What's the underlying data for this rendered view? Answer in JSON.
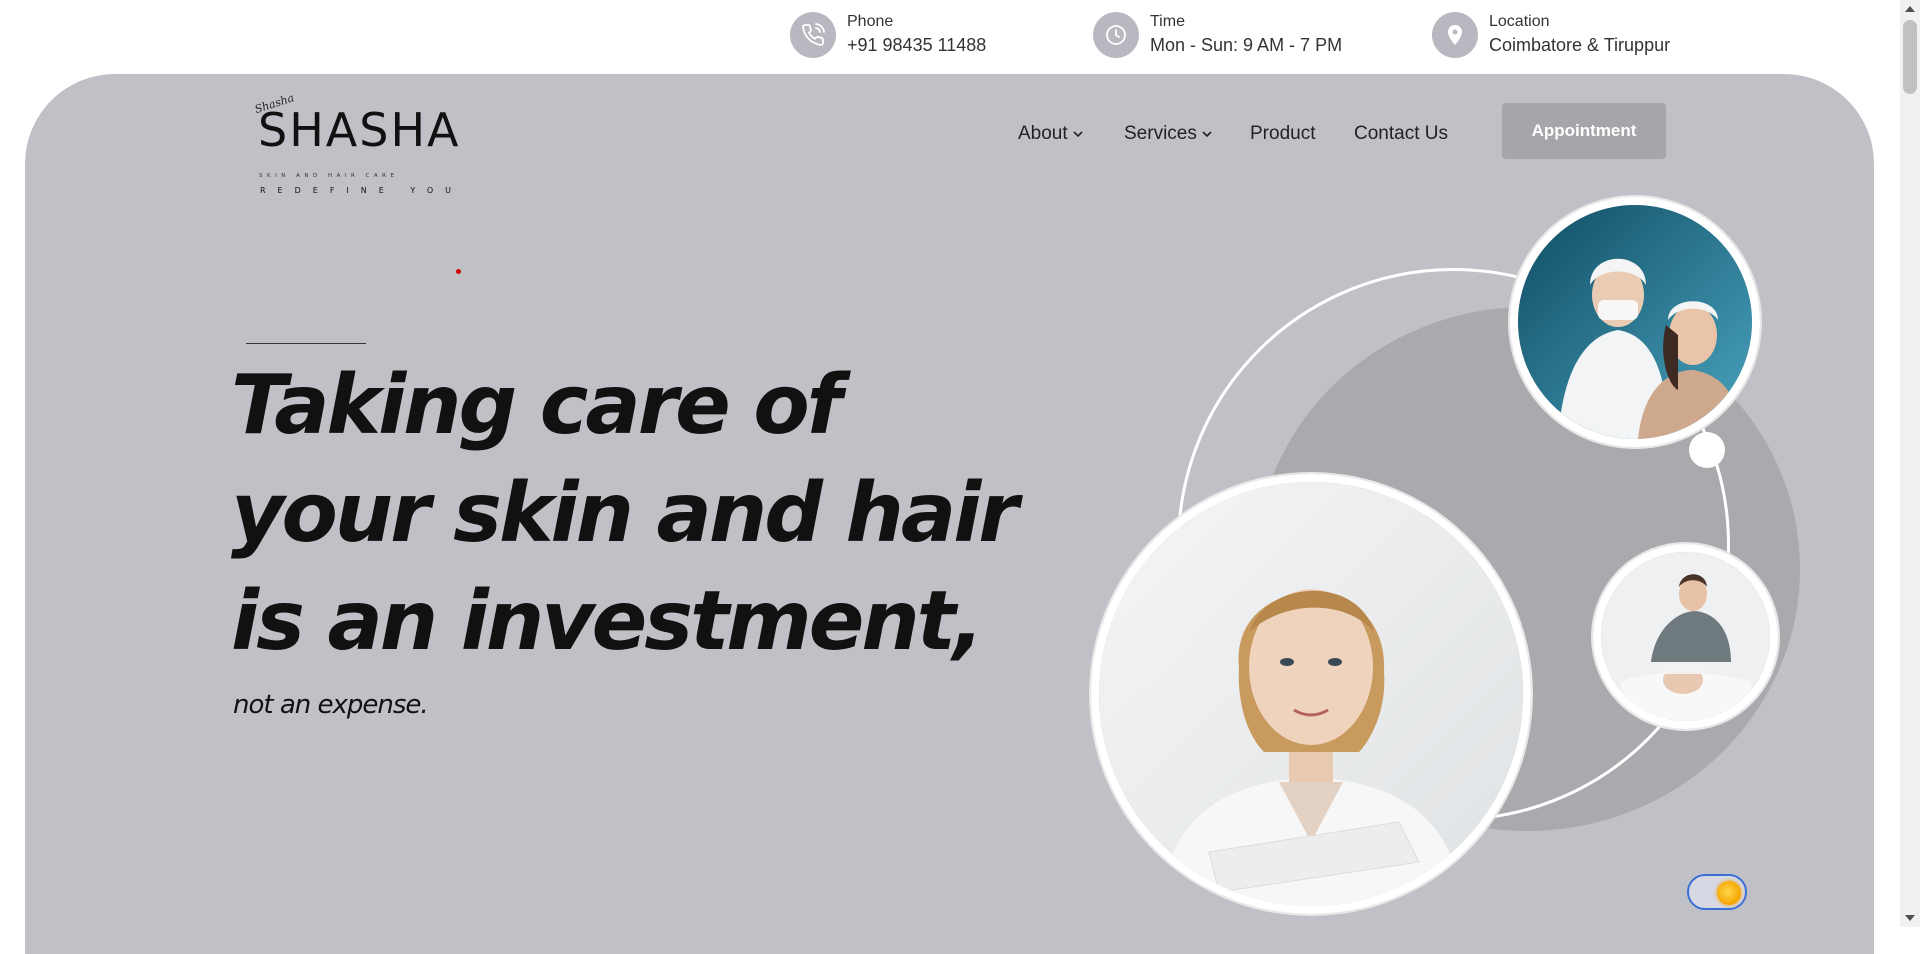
{
  "contact_bar": {
    "phone": {
      "icon": "phone-icon",
      "label": "Phone",
      "value": "+91 98435 11488"
    },
    "time": {
      "icon": "clock-icon",
      "label": "Time",
      "value": "Mon - Sun: 9 AM - 7 PM"
    },
    "location": {
      "icon": "location-pin-icon",
      "label": "Location",
      "value": "Coimbatore & Tiruppur"
    }
  },
  "brand": {
    "logo_text": "SHASHA",
    "logo_tagline": "SKIN AND HAIR CARE",
    "logo_motto": "REDEFINE YOU",
    "logo_signature": "Shasha"
  },
  "nav": {
    "items": [
      {
        "label": "About",
        "has_dropdown": true
      },
      {
        "label": "Services",
        "has_dropdown": true
      },
      {
        "label": "Product",
        "has_dropdown": false
      },
      {
        "label": "Contact Us",
        "has_dropdown": false
      }
    ],
    "cta_label": "Appointment"
  },
  "hero": {
    "headline_lines": [
      "Taking care of",
      "your skin and hair",
      "is an investment,"
    ],
    "subline": "not an expense."
  },
  "colors": {
    "panel_bg": "#c0c1c7",
    "icon_circle": "#b8b9c0",
    "cta_bg": "#a5a6aa",
    "accent_circle": "#a9aaae",
    "toggle_border": "#3b6fd8",
    "toggle_knob": "#f5a300"
  },
  "theme_toggle": {
    "icon": "sun-icon",
    "state": "light"
  }
}
